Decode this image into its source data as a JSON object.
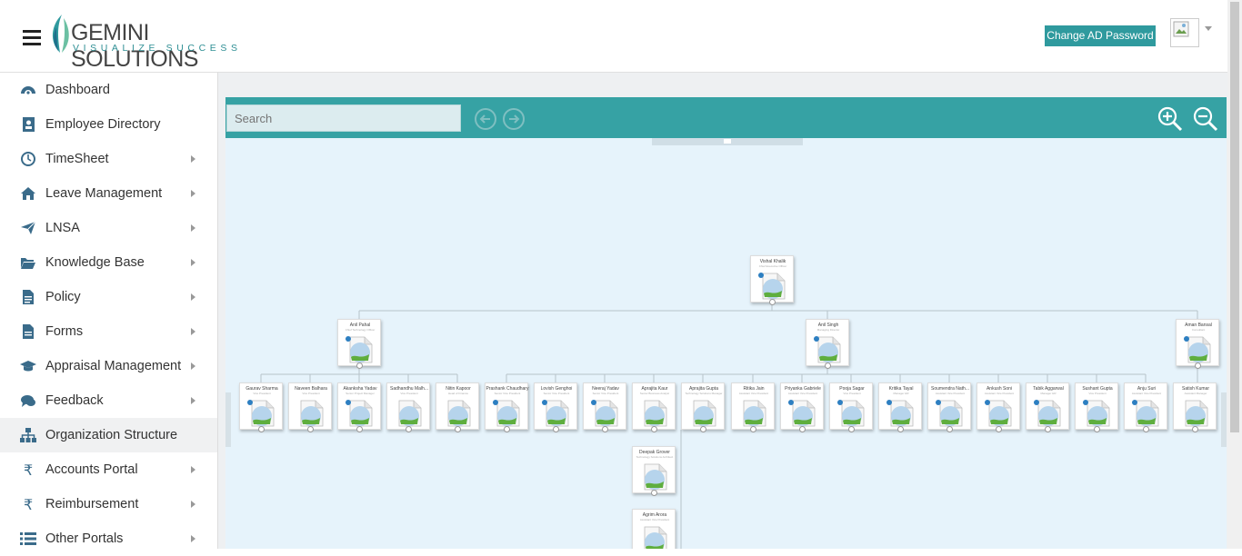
{
  "header": {
    "logo_name": "GEMINI SOLUTIONS",
    "logo_tagline": "VISUALIZE SUCCESS",
    "ad_password_button": "Change AD Password",
    "accent_color": "#2f9a9e"
  },
  "sidebar": {
    "items": [
      {
        "label": "Dashboard",
        "icon": "dashboard-icon",
        "has_submenu": false
      },
      {
        "label": "Employee Directory",
        "icon": "address-book-icon",
        "has_submenu": false
      },
      {
        "label": "TimeSheet",
        "icon": "clock-icon",
        "has_submenu": true
      },
      {
        "label": "Leave Management",
        "icon": "home-icon",
        "has_submenu": true
      },
      {
        "label": "LNSA",
        "icon": "paper-plane-icon",
        "has_submenu": true
      },
      {
        "label": "Knowledge Base",
        "icon": "folder-open-icon",
        "has_submenu": true
      },
      {
        "label": "Policy",
        "icon": "document-icon",
        "has_submenu": true
      },
      {
        "label": "Forms",
        "icon": "form-icon",
        "has_submenu": true
      },
      {
        "label": "Appraisal Management",
        "icon": "graduation-cap-icon",
        "has_submenu": true
      },
      {
        "label": "Feedback",
        "icon": "chat-icon",
        "has_submenu": true
      },
      {
        "label": "Organization Structure",
        "icon": "sitemap-icon",
        "has_submenu": false,
        "active": true
      },
      {
        "label": "Accounts Portal",
        "icon": "rupee-icon",
        "has_submenu": true
      },
      {
        "label": "Reimbursement",
        "icon": "rupee-icon",
        "has_submenu": true
      },
      {
        "label": "Other Portals",
        "icon": "list-icon",
        "has_submenu": true
      }
    ]
  },
  "org_toolbar": {
    "search_placeholder": "Search"
  },
  "org_chart": {
    "root": {
      "name": "Vishal Khalik",
      "role": "Chief Executive Officer"
    },
    "level2": [
      {
        "name": "Anil Pahal",
        "role": "Chief Technology Officer"
      },
      {
        "name": "Anil Singh",
        "role": "Managing Director"
      },
      {
        "name": "Aman Bansal",
        "role": "Consultant"
      }
    ],
    "level3": [
      {
        "name": "Gaurav Sharma",
        "role": "Vice President"
      },
      {
        "name": "Naveen Balhara",
        "role": "Vice President"
      },
      {
        "name": "Akanksha Yadav",
        "role": "Senior Project Manager"
      },
      {
        "name": "Sadhandhu Malh...",
        "role": "Vice President"
      },
      {
        "name": "Nitin Kapoor",
        "role": "Head of Finance"
      },
      {
        "name": "Prashank Chaudhary",
        "role": "Senior Vice President"
      },
      {
        "name": "Lovish Genghoi",
        "role": "Senior Vice President"
      },
      {
        "name": "Neeraj Yadav",
        "role": "Senior Vice President"
      },
      {
        "name": "Aprajita Kaur",
        "role": "Senior Business Analyst"
      },
      {
        "name": "Aprajita Gupta",
        "role": "Technology Solutions Manager"
      },
      {
        "name": "Ritika Jain",
        "role": "Assistant Vice President"
      },
      {
        "name": "Priyanka Gabriele",
        "role": "Assistant Vice President"
      },
      {
        "name": "Pooja Sagar",
        "role": "Vice President"
      },
      {
        "name": "Kritika Tayal",
        "role": "Manager HR"
      },
      {
        "name": "Soumendra Nath...",
        "role": "Assistant Vice President"
      },
      {
        "name": "Ankush Soni",
        "role": "Assistant Vice President"
      },
      {
        "name": "Tabik Aggarwal",
        "role": "Manager HR"
      },
      {
        "name": "Sushant Gupta",
        "role": "Vice President"
      },
      {
        "name": "Anju Suri",
        "role": "Assistant Vice President"
      },
      {
        "name": "Satish Kumar",
        "role": "Assistant Manager"
      }
    ],
    "level4": [
      {
        "name": "Deepak Grover",
        "role": "Technology Solutions Architect"
      },
      {
        "name": "Agrim Arora",
        "role": "Assistant Vice President"
      }
    ]
  }
}
